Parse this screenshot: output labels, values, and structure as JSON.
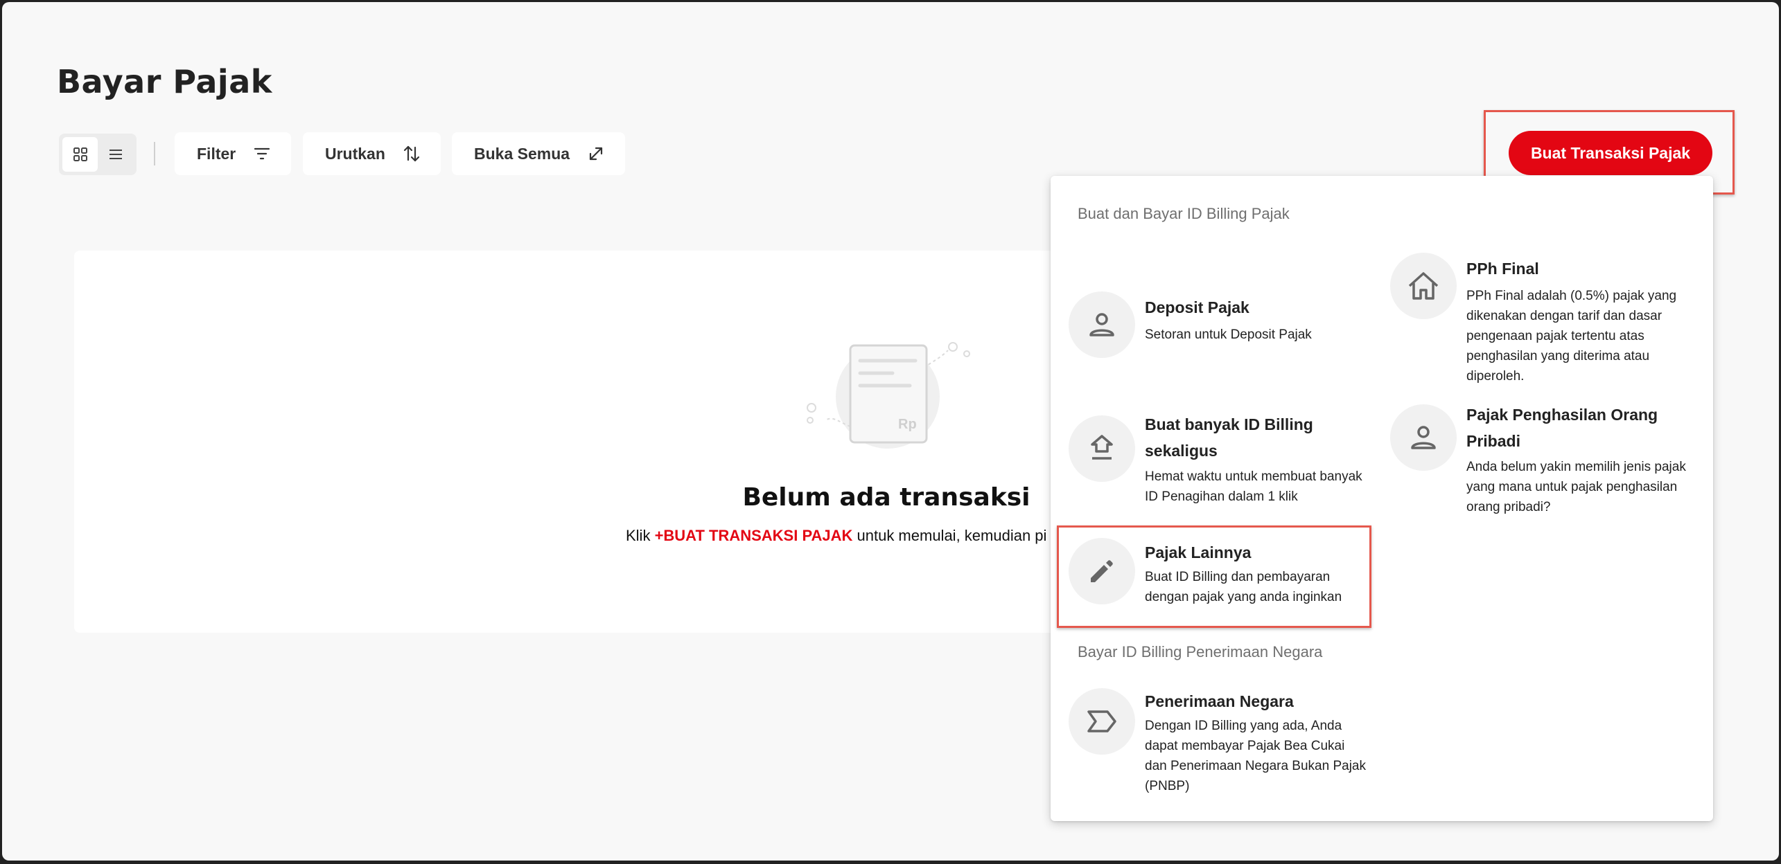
{
  "page": {
    "title": "Bayar Pajak"
  },
  "toolbar": {
    "filter_label": "Filter",
    "sort_label": "Urutkan",
    "expand_label": "Buka Semua",
    "create_button_label": "Buat Transaksi Pajak",
    "view_mode": "grid"
  },
  "empty_state": {
    "title": "Belum ada transaksi",
    "desc_prefix": "Klik ",
    "desc_highlight": "+BUAT TRANSAKSI PAJAK",
    "desc_suffix": " untuk memulai, kemudian pi",
    "illustration_label": "Rp"
  },
  "dropdown": {
    "section1_label": "Buat dan Bayar ID Billing Pajak",
    "section2_label": "Bayar ID Billing Penerimaan Negara",
    "options": {
      "deposit": {
        "title": "Deposit Pajak",
        "desc": "Setoran untuk Deposit Pajak"
      },
      "pph_final": {
        "title": "PPh Final",
        "desc": "PPh Final adalah (0.5%) pajak yang dikenakan dengan tarif dan dasar pengenaan pajak tertentu atas penghasilan yang diterima atau diperoleh."
      },
      "bulk": {
        "title": "Buat banyak ID Billing sekaligus",
        "desc": "Hemat waktu untuk membuat banyak ID Penagihan dalam 1 klik"
      },
      "pribadi": {
        "title": "Pajak Penghasilan Orang Pribadi",
        "desc": "Anda belum yakin memilih jenis pajak yang mana untuk pajak penghasilan orang pribadi?"
      },
      "lainnya": {
        "title": "Pajak Lainnya",
        "desc": "Buat ID Billing dan pembayaran dengan pajak yang anda inginkan"
      },
      "penerimaan": {
        "title": "Penerimaan Negara",
        "desc": "Dengan ID Billing yang ada, Anda dapat membayar Pajak Bea Cukai dan Penerimaan Negara Bukan Pajak (PNBP)"
      }
    }
  },
  "colors": {
    "brand_red": "#e30613",
    "highlight_box": "#e5584d",
    "page_bg": "#f8f8f8"
  }
}
